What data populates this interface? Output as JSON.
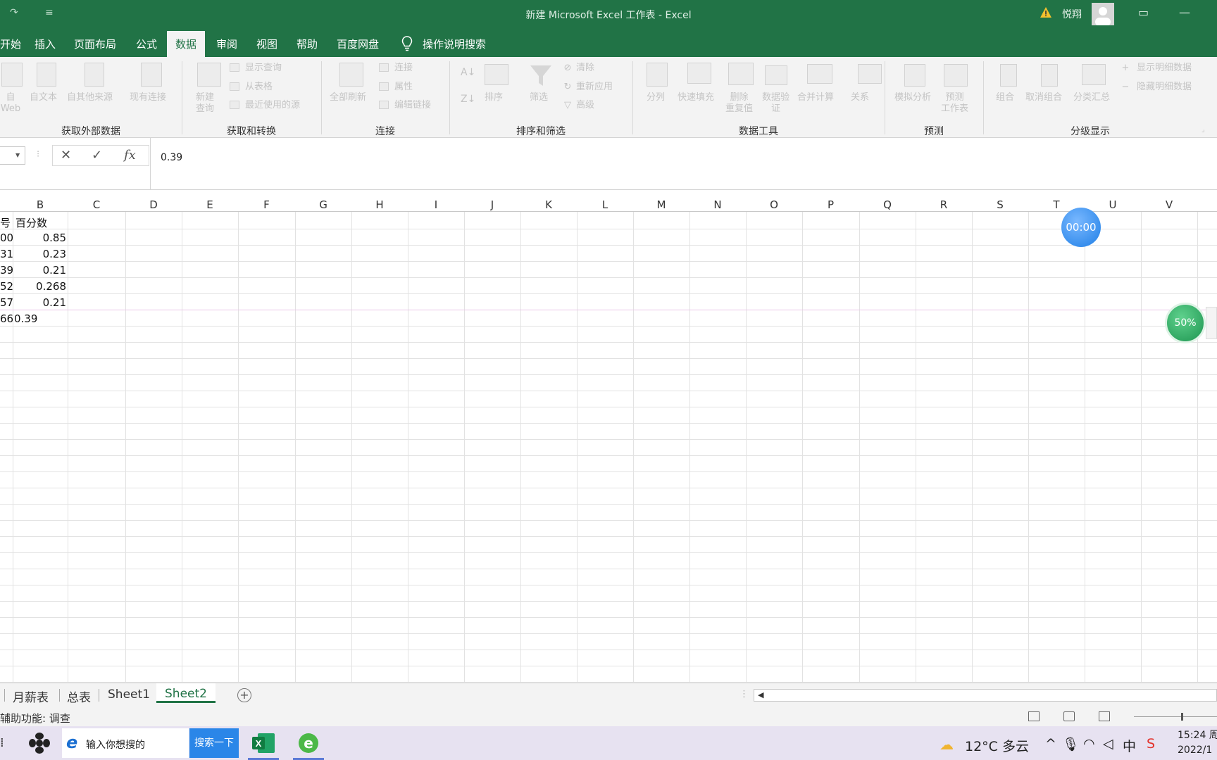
{
  "window": {
    "title": "新建 Microsoft Excel 工作表  -  Excel",
    "user_name": "悦翔"
  },
  "menu": {
    "tabs": [
      "开始",
      "插入",
      "页面布局",
      "公式",
      "数据",
      "审阅",
      "视图",
      "帮助",
      "百度网盘"
    ],
    "active_tab": "数据",
    "search_label": "操作说明搜索"
  },
  "ribbon": {
    "groups": {
      "external": "获取外部数据",
      "transform": "获取和转换",
      "connections": "连接",
      "sort_filter": "排序和筛选",
      "data_tools": "数据工具",
      "forecast": "预测",
      "outline": "分级显示"
    },
    "buttons": {
      "from_web": "自\nWeb",
      "from_text": "自文本",
      "from_other": "自其他来源",
      "existing": "现有连接",
      "new_query": "新建\n查询",
      "show_queries": "显示查询",
      "from_table": "从表格",
      "recent_sources": "最近使用的源",
      "refresh_all": "全部刷新",
      "connections": "连接",
      "properties": "属性",
      "edit_links": "编辑链接",
      "sort": "排序",
      "filter": "筛选",
      "clear": "清除",
      "reapply": "重新应用",
      "advanced": "高级",
      "text_to_columns": "分列",
      "flash_fill": "快速填充",
      "remove_duplicates": "删除\n重复值",
      "validation": "数据验\n证",
      "consolidate": "合并计算",
      "relationships": "关系",
      "what_if": "模拟分析",
      "forecast_sheet": "预测\n工作表",
      "group": "组合",
      "ungroup": "取消组合",
      "subtotal": "分类汇总",
      "show_detail": "显示明细数据",
      "hide_detail": "隐藏明细数据"
    }
  },
  "formula_bar": {
    "value": "0.39"
  },
  "grid": {
    "columns": [
      "B",
      "C",
      "D",
      "E",
      "F",
      "G",
      "H",
      "I",
      "J",
      "K",
      "L",
      "M",
      "N",
      "O",
      "P",
      "Q",
      "R",
      "S",
      "T",
      "U",
      "V"
    ],
    "header_row": {
      "a_partial": "号",
      "b": "百分数"
    },
    "rows": [
      {
        "a_partial": "00",
        "b": "0.85"
      },
      {
        "a_partial": "31",
        "b": "0.23"
      },
      {
        "a_partial": "39",
        "b": "0.21"
      },
      {
        "a_partial": "52",
        "b": "0.268"
      },
      {
        "a_partial": "57",
        "b": "0.21"
      },
      {
        "a_partial": "66",
        "b": "0.39"
      }
    ]
  },
  "widgets": {
    "timer": "00:00",
    "percent": "50%"
  },
  "sheets": {
    "tabs": [
      "月薪表",
      "总表",
      "Sheet1",
      "Sheet2"
    ],
    "active": "Sheet2"
  },
  "status": {
    "text": "辅助功能: 调查"
  },
  "taskbar": {
    "search_placeholder": "输入你想搜的",
    "search_button": "搜索一下",
    "weather": "12°C 多云",
    "ime": "中",
    "time": "15:24 周",
    "date": "2022/1"
  }
}
